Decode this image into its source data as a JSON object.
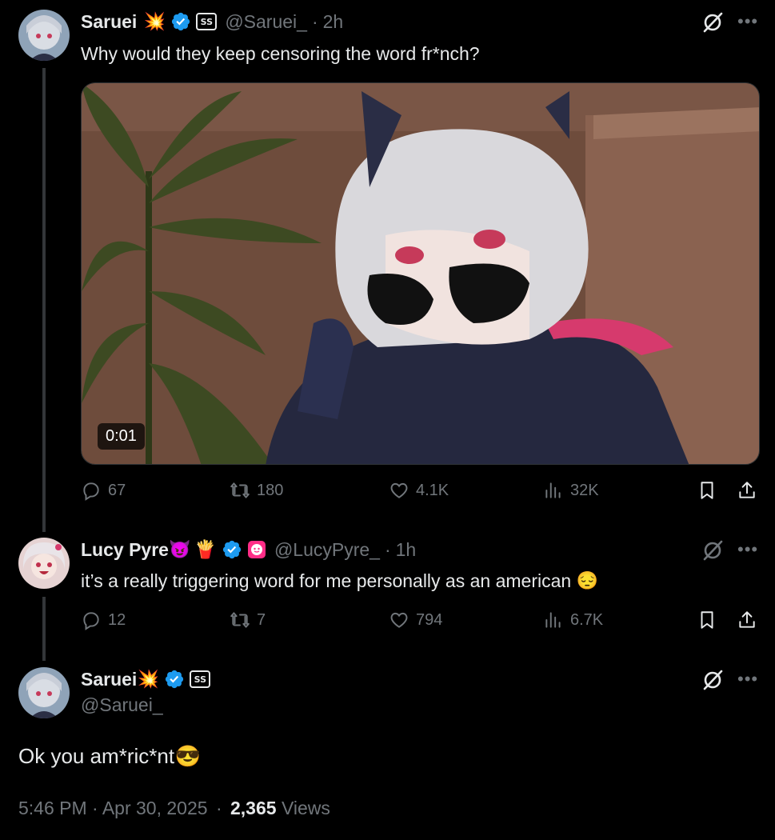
{
  "colors": {
    "background": "#000000",
    "text": "#e7e9ea",
    "muted": "#71767b",
    "verified": "#1d9bf0"
  },
  "tweet1": {
    "name": "Saruei",
    "name_emoji": "💥",
    "handle": "@Saruei_",
    "time": "2h",
    "text": "Why would they keep censoring the word fr*nch?",
    "video_duration": "0:01",
    "replies": "67",
    "reposts": "180",
    "likes": "4.1K",
    "views": "32K"
  },
  "tweet2": {
    "name": "Lucy Pyre",
    "name_emojis": [
      "😈",
      "🍟"
    ],
    "handle": "@LucyPyre_",
    "time": "1h",
    "text": "it’s a really triggering word for me personally as an american",
    "text_emoji": "😔",
    "replies": "12",
    "reposts": "7",
    "likes": "794",
    "views": "6.7K"
  },
  "tweet3": {
    "name": "Saruei",
    "name_emoji": "💥",
    "handle": "@Saruei_",
    "text": "Ok you am*ric*nt",
    "text_emoji": "😎",
    "timestamp": "5:46 PM · Apr 30, 2025",
    "views_count": "2,365",
    "views_label": "Views"
  },
  "separator": "·"
}
